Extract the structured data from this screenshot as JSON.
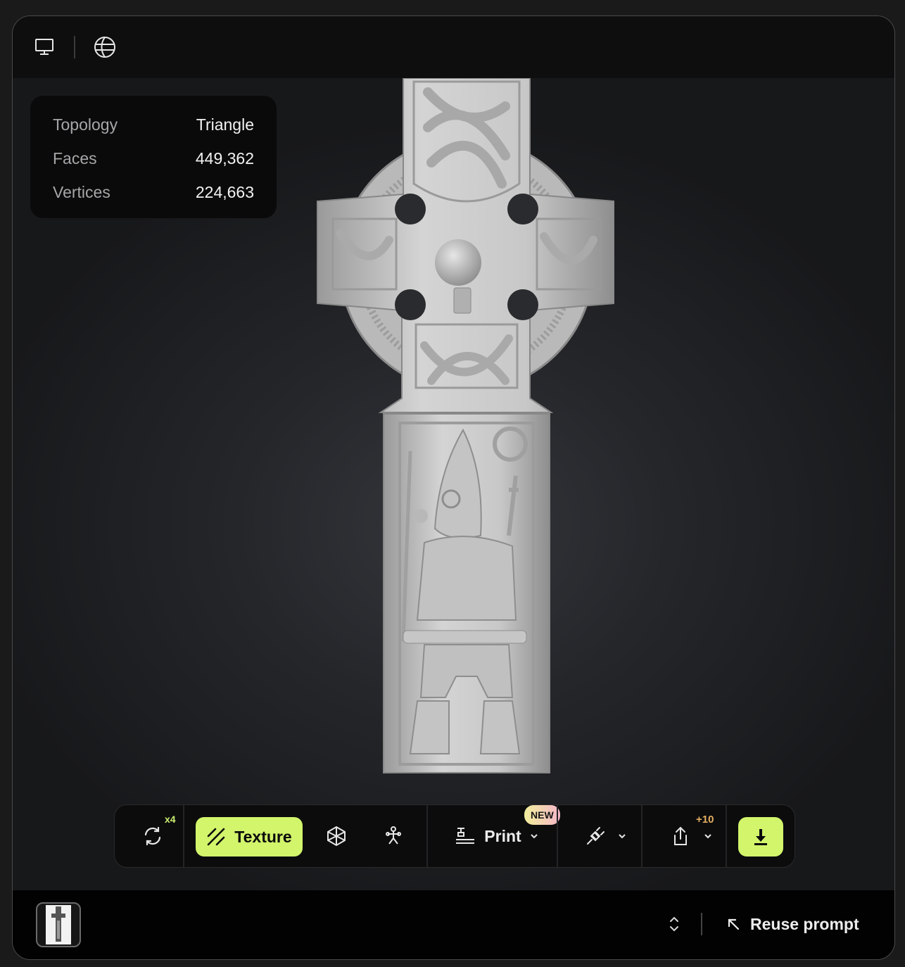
{
  "toolbar_top": {
    "icons": [
      "monitor-icon",
      "globe-icon"
    ]
  },
  "stats": {
    "topology_label": "Topology",
    "topology_value": "Triangle",
    "faces_label": "Faces",
    "faces_value": "449,362",
    "vertices_label": "Vertices",
    "vertices_value": "224,663"
  },
  "toolbar": {
    "regenerate_badge": "x4",
    "texture_label": "Texture",
    "print_label": "Print",
    "new_badge": "NEW",
    "share_badge": "+10"
  },
  "bottom": {
    "reuse_label": "Reuse prompt"
  },
  "colors": {
    "accent": "#d2f56b",
    "background": "#141415"
  }
}
